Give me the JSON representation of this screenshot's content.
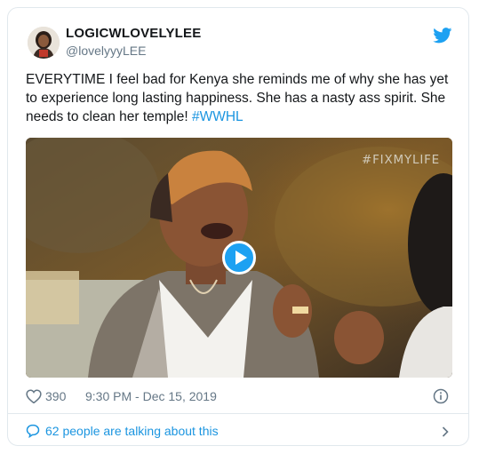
{
  "tweet": {
    "author": {
      "display_name": "LOGICWLOVELYLEE",
      "handle": "@lovelyyyLEE",
      "avatar_icon": "avatar"
    },
    "text_body": "EVERYTIME I feel bad for Kenya she reminds me of why she has yet to experience long lasting happiness. She has a nasty ass spirit. She needs to clean her temple! ",
    "hashtag": "#WWHL",
    "media": {
      "watermark": "#FIXMYLIFE",
      "play_icon": "play-icon"
    },
    "likes": "390",
    "timestamp": "9:30 PM - Dec 15, 2019",
    "talking_about": "62 people are talking about this"
  },
  "colors": {
    "accent": "#1da1f2",
    "link": "#1b95e0",
    "secondary_text": "#657786",
    "border": "#e1e8ed"
  },
  "icons": [
    "twitter-bird-icon",
    "play-icon",
    "heart-icon",
    "info-icon",
    "comment-icon",
    "chevron-right-icon"
  ]
}
